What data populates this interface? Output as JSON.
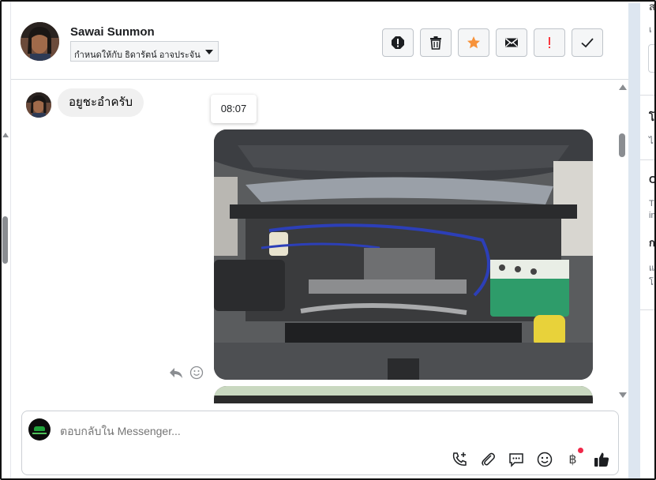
{
  "conversation": {
    "user_name": "Sawai Sunmon",
    "assign_label": "กำหนดให้กับ ธิดารัตน์ อาจประจัน"
  },
  "toolbar": {
    "buttons": [
      {
        "icon": "spam-alert-icon",
        "label": "Spam"
      },
      {
        "icon": "trash-icon",
        "label": "Delete"
      },
      {
        "icon": "star-icon",
        "label": "Star",
        "color": "#f7923a"
      },
      {
        "icon": "envelope-icon",
        "label": "Mark unread"
      },
      {
        "icon": "exclamation-icon",
        "label": "Follow up",
        "color": "#fa383e"
      },
      {
        "icon": "checkmark-icon",
        "label": "Done"
      }
    ]
  },
  "messages": [
    {
      "type": "text",
      "text": "อยูชะอำครับ"
    },
    {
      "type": "timestamp",
      "text": "08:07"
    },
    {
      "type": "photo",
      "subject": "engine-bay-photo"
    }
  ],
  "composer": {
    "placeholder": "ตอบกลับใน Messenger...",
    "tools": [
      "call-add-icon",
      "attachment-icon",
      "saved-reply-icon",
      "emoji-icon",
      "baht-payment-icon",
      "like-thumb-icon"
    ],
    "payment_symbol": "฿"
  },
  "right_panel": {
    "fragments": [
      "ส",
      "เ",
      "โ",
      "ไ",
      "C",
      "T",
      "in",
      "ก",
      "แ",
      "โ"
    ]
  },
  "colors": {
    "accent": "#1877f2",
    "star": "#f7923a",
    "alert_red": "#fa383e",
    "bubble_bg": "#f0f0f0",
    "notify_dot": "#f02849"
  }
}
